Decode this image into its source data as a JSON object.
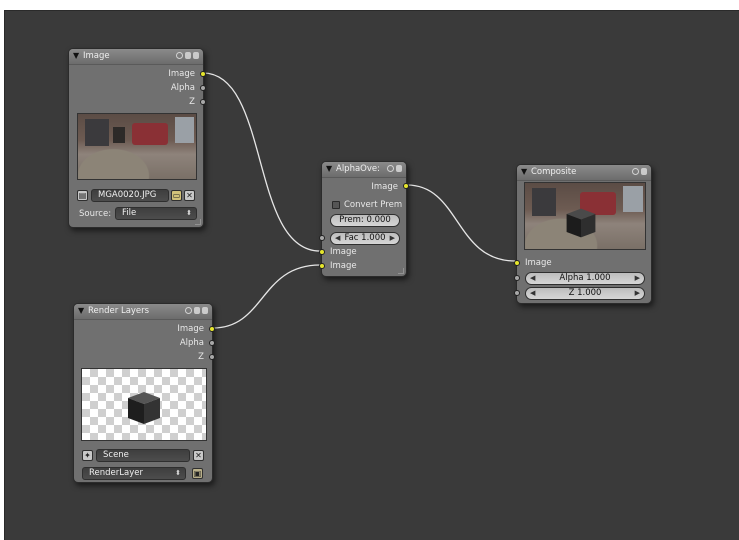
{
  "nodes": {
    "image": {
      "title": "Image",
      "outputs": [
        "Image",
        "Alpha",
        "Z"
      ],
      "filename": "MGA0020.JPG",
      "source_label": "Source:",
      "source_value": "File"
    },
    "alphaover": {
      "title": "AlphaOve:",
      "output": "Image",
      "convert_prem_label": "Convert Prem",
      "premul_field": "Prem: 0.000",
      "fac_field": "Fac 1.000",
      "inputs": [
        "Image",
        "Image"
      ]
    },
    "composite": {
      "title": "Composite",
      "input": "Image",
      "alpha_field": "Alpha 1.000",
      "z_field": "Z 1.000"
    },
    "render_layers": {
      "title": "Render Layers",
      "outputs": [
        "Image",
        "Alpha",
        "Z"
      ],
      "scene": "Scene",
      "layer": "RenderLayer"
    }
  },
  "colors": {
    "canvas": "#3a3a3a",
    "node_body": "#707070",
    "image_socket": "#e6e62c",
    "value_socket": "#a8a8a8",
    "wire": "#e6e6e6"
  },
  "icons": {
    "collapse": "triangle-down-icon",
    "image_browse": "image-icon",
    "folder": "folder-icon",
    "close": "x-icon",
    "scene": "scene-icon",
    "render": "render-icon"
  }
}
